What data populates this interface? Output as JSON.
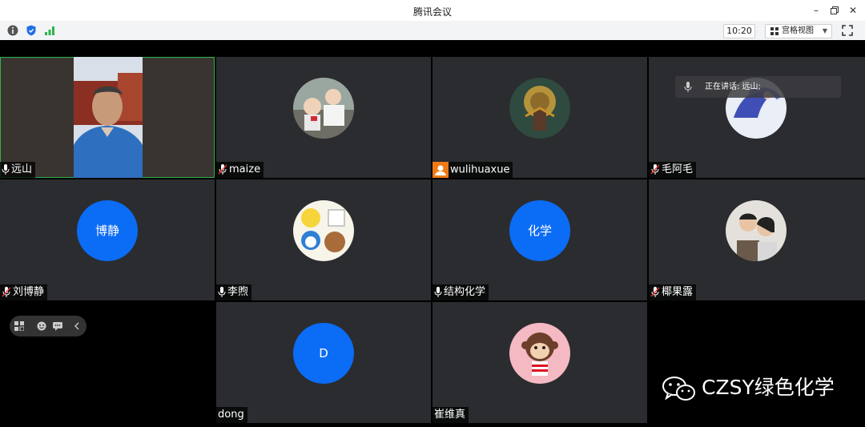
{
  "window": {
    "title": "腾讯会议"
  },
  "toolbar": {
    "time": "10:20",
    "view_label": "宫格视图"
  },
  "speaking": {
    "text": "正在讲话: 远山;"
  },
  "tiles": [
    {
      "name": "远山"
    },
    {
      "name": "maize"
    },
    {
      "name": "wulihuaxue"
    },
    {
      "name": "毛阿毛"
    },
    {
      "name": "刘博静",
      "avatar_text": "博静"
    },
    {
      "name": "李煦"
    },
    {
      "name": "结构化学",
      "avatar_text": "化学"
    },
    {
      "name": "椰果露"
    },
    {
      "name": "dong",
      "avatar_text": "D"
    },
    {
      "name": "崔维真"
    }
  ],
  "watermark": {
    "text": "CZSY绿色化学"
  },
  "colors": {
    "tile_bg": "#2b2c2f",
    "avatar_blue": "#0b6cf5",
    "active_border": "#2db34a",
    "signal_green": "#2db34a"
  }
}
